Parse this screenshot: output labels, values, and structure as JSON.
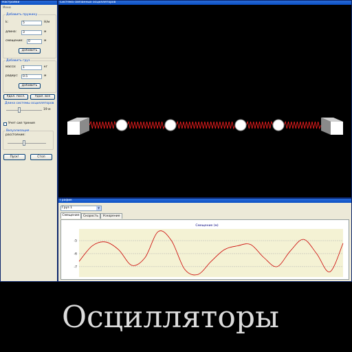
{
  "settings": {
    "title": "Настройки",
    "menu": "Меню",
    "spring_group": {
      "title": "Добавить пружину",
      "k_label": "k:",
      "k_value": "5",
      "k_unit": "Н/м",
      "length_label": "длина:",
      "length_value": "3",
      "length_unit": "м",
      "offset_label": "смещение:",
      "offset_value": "0",
      "offset_unit": "м",
      "add_button": "Добавить"
    },
    "mass_group": {
      "title": "Добавить груз",
      "mass_label": "масса:",
      "mass_value": "1",
      "mass_unit": "кг",
      "radius_label": "радиус:",
      "radius_value": "0.5",
      "radius_unit": "м",
      "add_button": "Добавить"
    },
    "delete_last_button": "Удал. посл.",
    "delete_all_button": "Удал. все",
    "system_length_title": "Длина системы осцилляторов",
    "system_length_value": "19 м",
    "friction_checkbox_label": "Учет сил трения",
    "viz_group": {
      "title": "Визуализация",
      "distance_label": "расстояние:"
    },
    "start_button": "Пуск!",
    "stop_button": "Стоп"
  },
  "oscillators": {
    "title": "Система связанных осцилляторов",
    "spring_color": "#ff2020"
  },
  "graph": {
    "title": "График",
    "selected_body": "Груз 1",
    "tabs": [
      "Смещение",
      "Скорость",
      "Ускорение"
    ],
    "active_tab": 0,
    "chart_title": "Смещение (м)",
    "y_ticks": [
      "-5",
      "-6",
      "-7"
    ]
  },
  "chart_data": {
    "type": "line",
    "title": "Смещение (м)",
    "xlabel": "",
    "ylabel": "",
    "ylim": [
      -7.8,
      -4.1
    ],
    "grid": true,
    "series": [
      {
        "color": "#cc0000",
        "x": [
          0,
          5,
          10,
          15,
          20,
          25,
          30,
          35,
          40,
          45,
          50,
          55,
          60,
          65,
          70,
          75,
          80,
          85,
          90,
          95,
          100
        ],
        "y": [
          -6.6,
          -5.4,
          -5.1,
          -5.7,
          -6.9,
          -6.3,
          -4.3,
          -5.0,
          -7.2,
          -7.6,
          -6.6,
          -5.7,
          -5.4,
          -5.3,
          -6.3,
          -7.0,
          -5.8,
          -4.9,
          -6.0,
          -7.4,
          -5.2
        ]
      }
    ]
  },
  "caption": "Осцилляторы"
}
